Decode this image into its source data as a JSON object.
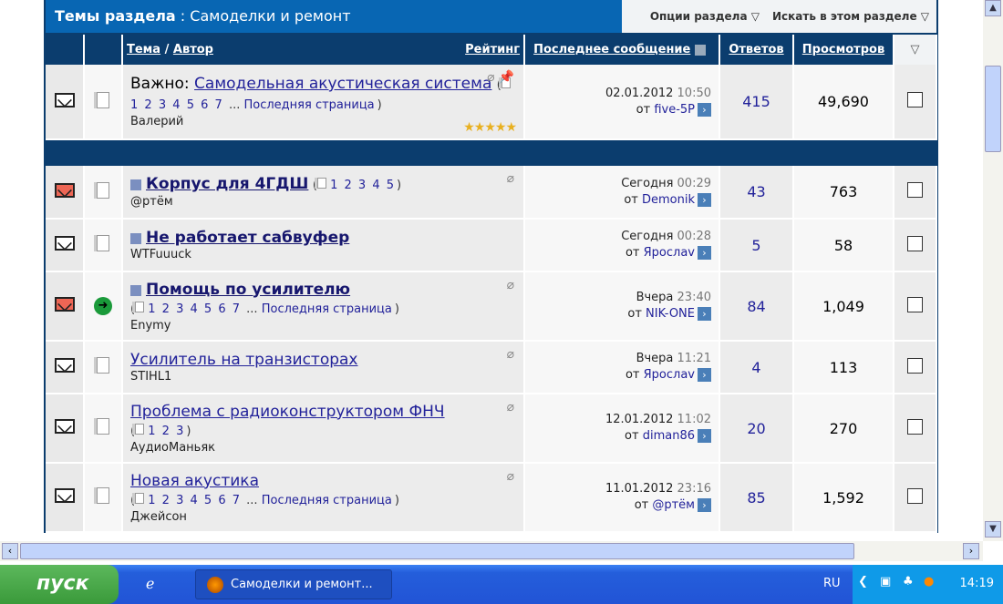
{
  "header": {
    "title_bold": "Темы раздела",
    "title_sep": " : ",
    "title_forum": "Самоделки и ремонт",
    "options": "Опции раздела ▽",
    "search": "Искать в этом разделе ▽"
  },
  "columns": {
    "topic": "Тема",
    "slash": " / ",
    "author": "Автор",
    "rating": "Рейтинг",
    "last_post": "Последнее сообщение",
    "replies": "Ответов",
    "views": "Просмотров",
    "menu": "▽"
  },
  "sticky": {
    "prefix": "Важно: ",
    "title": "Самодельная акустическая система",
    "pages": [
      "1",
      "2",
      "3",
      "4",
      "5",
      "6",
      "7"
    ],
    "ellipsis": "...",
    "last_page": "Последняя страница",
    "author": "Валерий",
    "rating": "★★★★★",
    "date": "02.01.2012",
    "time": "10:50",
    "by": "от",
    "last_user": "five-5P",
    "replies": "415",
    "views": "49,690"
  },
  "threads": [
    {
      "title": "Корпус для 4ГДШ",
      "bold": true,
      "hot": true,
      "icon": "doc",
      "clip": true,
      "pages": [
        "1",
        "2",
        "3",
        "4",
        "5"
      ],
      "last_page": "",
      "author": "@ртём",
      "date": "Сегодня",
      "time": "00:29",
      "last_user": "Demonik",
      "replies": "43",
      "views": "763"
    },
    {
      "title": "Не работает сабвуфер",
      "bold": true,
      "hot": false,
      "icon": "doc",
      "clip": false,
      "pages": [],
      "last_page": "",
      "author": "WTFuuuck",
      "date": "Сегодня",
      "time": "00:28",
      "last_user": "Ярослаv",
      "replies": "5",
      "views": "58"
    },
    {
      "title": "Помощь по усилителю",
      "bold": true,
      "hot": true,
      "icon": "arrow",
      "clip": true,
      "pages": [
        "1",
        "2",
        "3",
        "4",
        "5",
        "6",
        "7"
      ],
      "last_page": "Последняя страница",
      "author": "Enymy",
      "date": "Вчера",
      "time": "23:40",
      "last_user": "NIK-ONE",
      "replies": "84",
      "views": "1,049"
    },
    {
      "title": "Усилитель на транзисторах",
      "bold": false,
      "hot": false,
      "icon": "doc",
      "clip": true,
      "pages": [],
      "last_page": "",
      "author": "STIHL1",
      "date": "Вчера",
      "time": "11:21",
      "last_user": "Ярослаv",
      "replies": "4",
      "views": "113"
    },
    {
      "title": "Проблема с радиоконструктором ФНЧ",
      "bold": false,
      "hot": false,
      "icon": "doc",
      "clip": true,
      "pages": [
        "1",
        "2",
        "3"
      ],
      "last_page": "",
      "author": "АудиоМаньяк",
      "date": "12.01.2012",
      "time": "11:02",
      "last_user": "diman86",
      "replies": "20",
      "views": "270"
    },
    {
      "title": "Новая акустика",
      "bold": false,
      "hot": false,
      "icon": "doc",
      "clip": true,
      "pages": [
        "1",
        "2",
        "3",
        "4",
        "5",
        "6",
        "7"
      ],
      "last_page": "Последняя страница",
      "author": "Джейсон",
      "date": "11.01.2012",
      "time": "23:16",
      "last_user": "@ртём",
      "replies": "85",
      "views": "1,592"
    }
  ],
  "taskbar": {
    "start": "пуск",
    "window": "Самоделки и ремонт...",
    "lang": "RU",
    "clock": "14:19"
  },
  "colors": {
    "header_blue": "#0866b3",
    "navy": "#0b3d6e",
    "link": "#22229a"
  }
}
